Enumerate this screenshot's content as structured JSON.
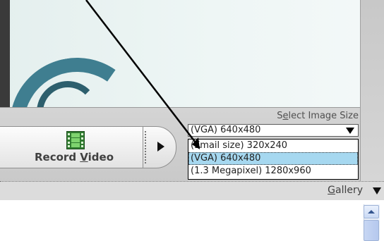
{
  "record_video": {
    "label_pre": "Record ",
    "label_accel": "V",
    "label_post": "ideo",
    "icon": "film-icon"
  },
  "play_button": {
    "icon": "play-arrow-icon"
  },
  "image_size": {
    "title_pre": "S",
    "title_accel": "e",
    "title_post": "lect Image Size",
    "selected_value": "(VGA) 640x480",
    "options": [
      "(Email size) 320x240",
      "(VGA) 640x480",
      "(1.3 Megapixel) 1280x960"
    ],
    "highlighted_index": 1
  },
  "gallery": {
    "label_accel": "G",
    "label_post": "allery",
    "arrow_icon": "chevron-down-icon"
  },
  "colors": {
    "selection": "#a6d8f0",
    "control_band": "#d4d4d4",
    "cable": "#3f7e90",
    "film_icon": "#2f7a2f"
  }
}
